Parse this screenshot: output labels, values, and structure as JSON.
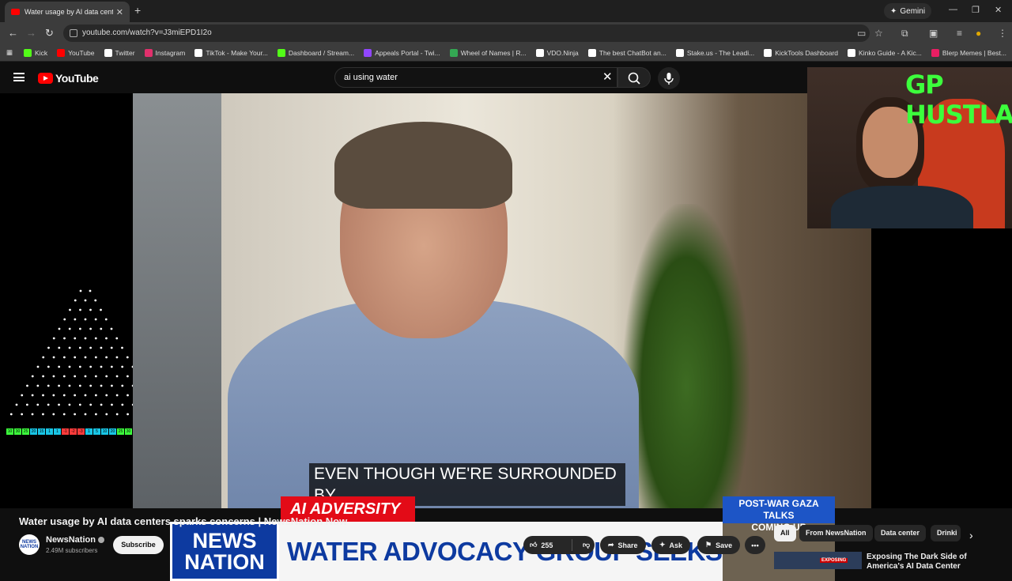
{
  "browser": {
    "tab_title": "Water usage by AI data centers",
    "new_tab": "+",
    "gemini_label": "Gemini",
    "url": "youtube.com/watch?v=J3miEPD1I2o",
    "bookmarks": [
      {
        "label": "Kick",
        "color": "#53fc18"
      },
      {
        "label": "YouTube",
        "color": "#ff0000"
      },
      {
        "label": "Twitter",
        "color": "#ffffff"
      },
      {
        "label": "Instagram",
        "color": "#e1306c"
      },
      {
        "label": "TikTok - Make Your...",
        "color": "#ffffff"
      },
      {
        "label": "Dashboard / Stream...",
        "color": "#53fc18"
      },
      {
        "label": "Appeals Portal - Twi...",
        "color": "#9146ff"
      },
      {
        "label": "Wheel of Names | R...",
        "color": "#34a853"
      },
      {
        "label": "VDO.Ninja",
        "color": "#ffffff"
      },
      {
        "label": "The best ChatBot an...",
        "color": "#ffffff"
      },
      {
        "label": "Stake.us - The Leadi...",
        "color": "#ffffff"
      },
      {
        "label": "KickTools Dashboard",
        "color": "#ffffff"
      },
      {
        "label": "Kinko Guide - A Kic...",
        "color": "#ffffff"
      },
      {
        "label": "Blerp Memes | Best...",
        "color": "#e91e63"
      }
    ]
  },
  "youtube": {
    "logo_text": "YouTube",
    "search_value": "ai using water"
  },
  "video": {
    "caption": "EVEN THOUGH WE'RE SURROUNDED BY",
    "topic_tag": "AI ADVERSITY",
    "logo_line1": "NEWS",
    "logo_line2": "NATION",
    "headline": "WATER ADVOCACY GROUP SEEKS REGULATION",
    "promo_line1": "POST-WAR GAZA TALKS",
    "promo_line2": "COMING UP",
    "webcam_handle": "GP HUSTLA",
    "scorebar": [
      {
        "t": "10",
        "c": "#3cff3c"
      },
      {
        "t": "30",
        "c": "#3cff3c"
      },
      {
        "t": "25",
        "c": "#3cff3c"
      },
      {
        "t": "20",
        "c": "#19c6e6"
      },
      {
        "t": "15",
        "c": "#19c6e6"
      },
      {
        "t": "1",
        "c": "#19c6e6"
      },
      {
        "t": "1",
        "c": "#19c6e6"
      },
      {
        "t": "-1",
        "c": "#ff3b3b"
      },
      {
        "t": "-2",
        "c": "#ff3b3b"
      },
      {
        "t": "-3",
        "c": "#ff3b3b"
      },
      {
        "t": "1",
        "c": "#19c6e6"
      },
      {
        "t": "5",
        "c": "#19c6e6"
      },
      {
        "t": "10",
        "c": "#19c6e6"
      },
      {
        "t": "20",
        "c": "#19c6e6"
      },
      {
        "t": "25",
        "c": "#3cff3c"
      },
      {
        "t": "30",
        "c": "#3cff3c"
      },
      {
        "t": "10",
        "c": "#3cff3c"
      }
    ]
  },
  "watch": {
    "title": "Water usage by AI data centers sparks concerns | NewsNation Now",
    "channel": "NewsNation",
    "avatar_text": "NEWS NATION",
    "subscribers": "2.49M subscribers",
    "subscribe_label": "Subscribe",
    "like_count": "255",
    "share_label": "Share",
    "ask_label": "Ask",
    "save_label": "Save",
    "more_label": "•••"
  },
  "sidebar": {
    "chips": [
      "All",
      "From NewsNation",
      "Data center",
      "Drinki"
    ],
    "rec_title": "Exposing The Dark Side of America's AI Data Center",
    "rec_badge": "EXPOSING"
  }
}
